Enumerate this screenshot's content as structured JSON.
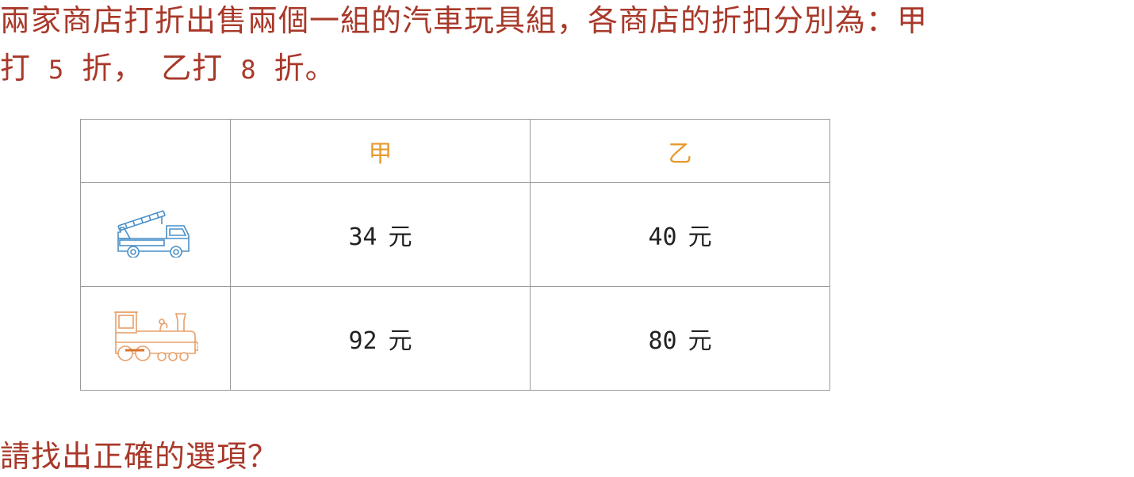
{
  "question": {
    "line1": "兩家商店打折出售兩個一組的汽車玩具組，各商店的折扣分別為：甲",
    "line2_parts": [
      "打",
      "5",
      "折，",
      "乙打",
      "8",
      "折。"
    ],
    "prompt": "請找出正確的選項？"
  },
  "table": {
    "headers": [
      "",
      "甲",
      "乙"
    ],
    "rows": [
      {
        "icon": "fire-truck-icon",
        "a_value": "34",
        "a_unit": "元",
        "b_value": "40",
        "b_unit": "元"
      },
      {
        "icon": "steam-train-icon",
        "a_value": "92",
        "a_unit": "元",
        "b_value": "80",
        "b_unit": "元"
      }
    ]
  },
  "colors": {
    "question_text": "#a8392a",
    "store_label": "#e69a2e",
    "truck_icon": "#4a90c8",
    "train_icon": "#e8a06a",
    "train_accent": "#d9742a",
    "grid_lines": "#9a9a9a"
  }
}
